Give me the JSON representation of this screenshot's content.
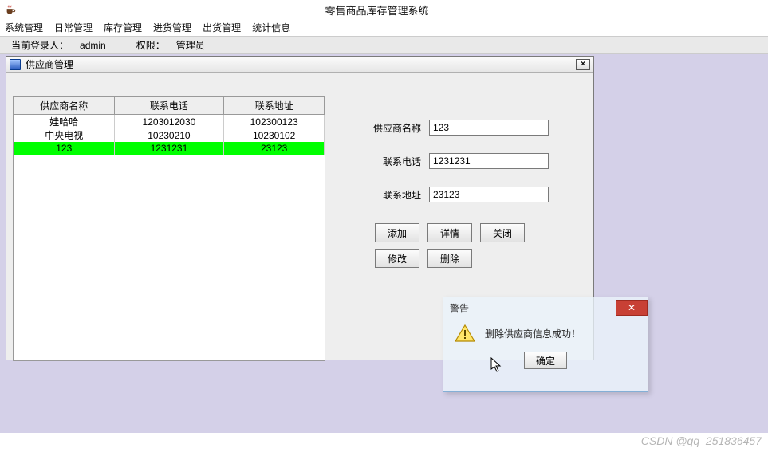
{
  "window": {
    "title": "零售商品库存管理系统"
  },
  "menubar": {
    "items": [
      "系统管理",
      "日常管理",
      "库存管理",
      "进货管理",
      "出货管理",
      "统计信息"
    ]
  },
  "status": {
    "login_label": "当前登录人：",
    "login_value": "admin",
    "role_label": "权限：",
    "role_value": "管理员"
  },
  "internal_window": {
    "title": "供应商管理",
    "close_glyph": "×"
  },
  "table": {
    "columns": [
      "供应商名称",
      "联系电话",
      "联系地址"
    ],
    "rows": [
      {
        "cells": [
          "娃哈哈",
          "1203012030",
          "102300123"
        ],
        "selected": false
      },
      {
        "cells": [
          "中央电视",
          "10230210",
          "10230102"
        ],
        "selected": false
      },
      {
        "cells": [
          "123",
          "1231231",
          "23123"
        ],
        "selected": true
      }
    ]
  },
  "form": {
    "fields": [
      {
        "label": "供应商名称",
        "value": "123",
        "name": "supplier-name"
      },
      {
        "label": "联系电话",
        "value": "1231231",
        "name": "phone"
      },
      {
        "label": "联系地址",
        "value": "23123",
        "name": "address"
      }
    ]
  },
  "buttons": {
    "add": "添加",
    "detail": "详情",
    "close": "关闭",
    "modify": "修改",
    "delete": "删除"
  },
  "dialog": {
    "title": "警告",
    "message": "删除供应商信息成功！",
    "ok": "确定",
    "close_glyph": "✕"
  },
  "watermark": "CSDN @qq_251836457"
}
